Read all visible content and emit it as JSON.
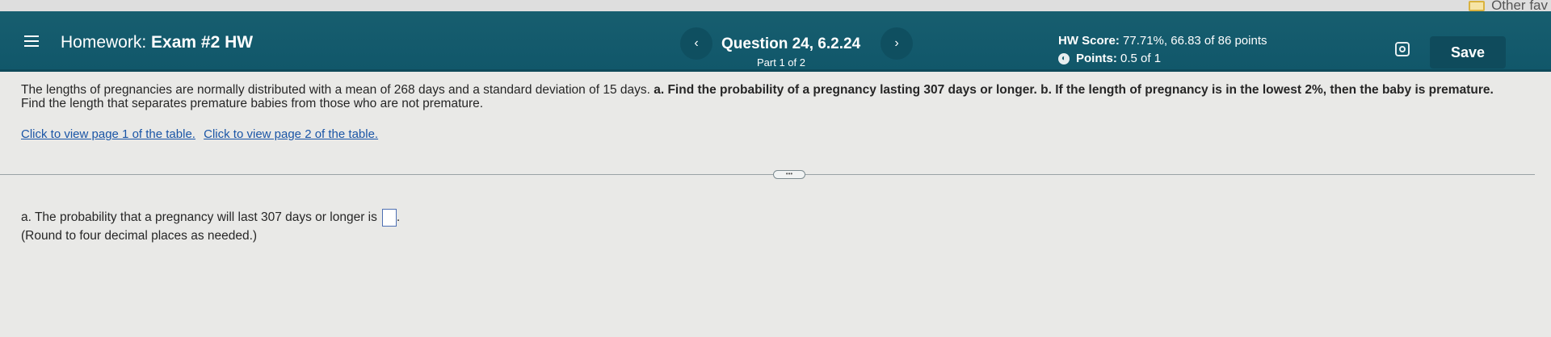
{
  "browser": {
    "bookmark_folder": "Other fav"
  },
  "header": {
    "homework_prefix": "Homework:",
    "homework_name": "Exam #2 HW",
    "question_title": "Question 24, 6.2.24",
    "part": "Part 1 of 2",
    "prev_icon": "‹",
    "next_icon": "›",
    "score_label": "HW Score:",
    "score_value": "77.71%, 66.83 of 86 points",
    "points_label": "Points:",
    "points_value": "0.5 of 1",
    "save_label": "Save"
  },
  "question": {
    "intro": "The lengths of pregnancies are normally distributed with a mean of 268 days and a standard deviation of 15 days.",
    "part_a": "a. Find the probability of a pregnancy lasting 307 days or longer.",
    "part_b": "b. If the length of pregnancy is in the lowest 2%, then the baby is premature.",
    "part_b_cont": "Find the length that separates premature babies from those who are not premature.",
    "link1": "Click to view page 1 of the table.",
    "link2": "Click to view page 2 of the table."
  },
  "divider_handle": "•••",
  "answer": {
    "prompt": "a. The probability that a pregnancy will last 307 days or longer is",
    "value": "",
    "note": "(Round to four decimal places as needed.)"
  }
}
